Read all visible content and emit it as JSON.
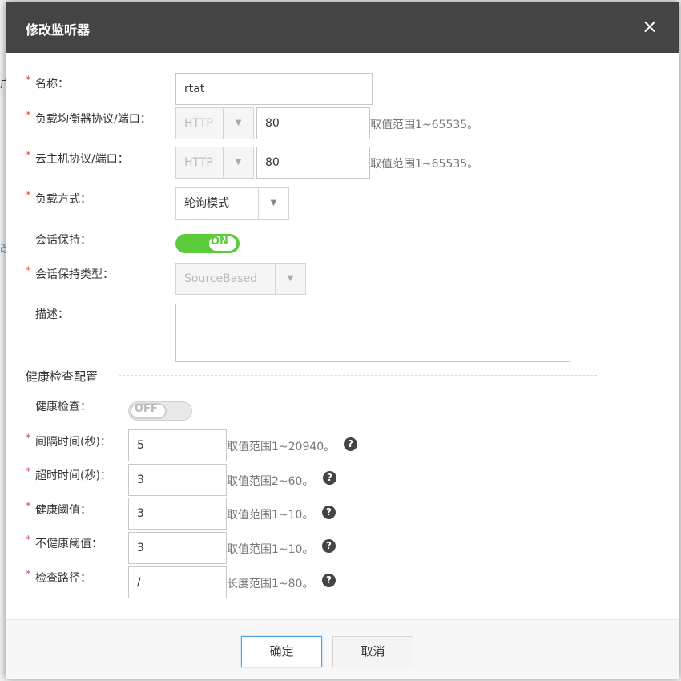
{
  "background": {
    "frag1": "广",
    "frag2": "改"
  },
  "dialog": {
    "title": "修改监听器",
    "close_glyph": "×"
  },
  "form": {
    "required_mark": "*",
    "name": {
      "label": "名称：",
      "value": "rtat"
    },
    "lb_protocol": {
      "label": "负载均衡器协议/端口：",
      "protocol": "HTTP",
      "port": "80",
      "hint": "取值范围1~65535。"
    },
    "vm_protocol": {
      "label": "云主机协议/端口：",
      "protocol": "HTTP",
      "port": "80",
      "hint": "取值范围1~65535。"
    },
    "lb_method": {
      "label": "负载方式：",
      "value": "轮询模式"
    },
    "session_persistence": {
      "label": "会话保持：",
      "state": "ON"
    },
    "session_type": {
      "label": "会话保持类型：",
      "value": "SourceBased"
    },
    "description": {
      "label": "描述：",
      "value": ""
    }
  },
  "health": {
    "section_title": "健康检查配置",
    "check": {
      "label": "健康检查：",
      "state": "OFF"
    },
    "interval": {
      "label": "间隔时间(秒)：",
      "value": "5",
      "hint": "取值范围1~20940。"
    },
    "timeout": {
      "label": "超时时间(秒)：",
      "value": "3",
      "hint": "取值范围2~60。"
    },
    "healthy_threshold": {
      "label": "健康阈值：",
      "value": "3",
      "hint": "取值范围1~10。"
    },
    "unhealthy_threshold": {
      "label": "不健康阈值：",
      "value": "3",
      "hint": "取值范围1~10。"
    },
    "check_path": {
      "label": "检查路径：",
      "value": "/",
      "hint": "长度范围1~80。"
    },
    "help_glyph": "?"
  },
  "footer": {
    "confirm_label": "确定",
    "cancel_label": "取消"
  },
  "colors": {
    "header_bg": "#444444",
    "toggle_on": "#5ccb3c",
    "primary_border": "#4ea2e0",
    "required": "#e04545"
  }
}
